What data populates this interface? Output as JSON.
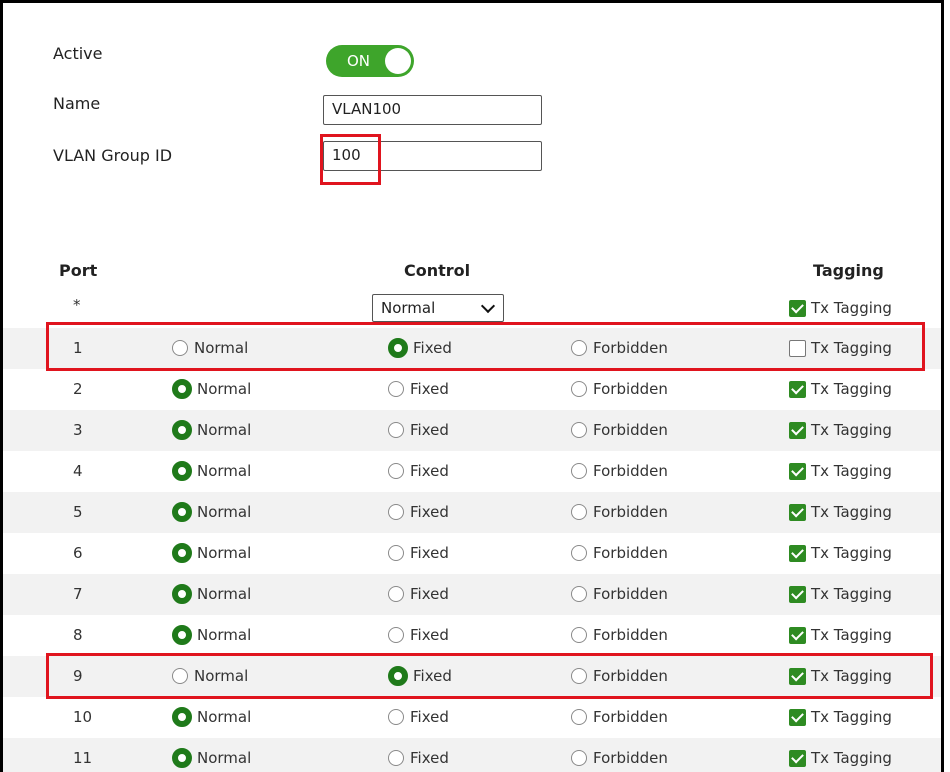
{
  "form": {
    "active_label": "Active",
    "toggle_label": "ON",
    "name_label": "Name",
    "name_value": "VLAN100",
    "vlan_group_id_label": "VLAN Group ID",
    "vlan_group_id_value": "100"
  },
  "table": {
    "headers": {
      "port": "Port",
      "control": "Control",
      "tagging": "Tagging"
    },
    "all_row": {
      "port": "*",
      "control_select": "Normal",
      "tagging_label": "Tx Tagging",
      "tagging_checked": true
    },
    "option_labels": {
      "normal": "Normal",
      "fixed": "Fixed",
      "forbidden": "Forbidden",
      "tx_tagging": "Tx Tagging"
    },
    "rows": [
      {
        "port": "1",
        "control": "fixed",
        "tx_tagging": false
      },
      {
        "port": "2",
        "control": "normal",
        "tx_tagging": true
      },
      {
        "port": "3",
        "control": "normal",
        "tx_tagging": true
      },
      {
        "port": "4",
        "control": "normal",
        "tx_tagging": true
      },
      {
        "port": "5",
        "control": "normal",
        "tx_tagging": true
      },
      {
        "port": "6",
        "control": "normal",
        "tx_tagging": true
      },
      {
        "port": "7",
        "control": "normal",
        "tx_tagging": true
      },
      {
        "port": "8",
        "control": "normal",
        "tx_tagging": true
      },
      {
        "port": "9",
        "control": "fixed",
        "tx_tagging": true
      },
      {
        "port": "10",
        "control": "normal",
        "tx_tagging": true
      },
      {
        "port": "11",
        "control": "normal",
        "tx_tagging": true
      }
    ]
  },
  "colors": {
    "accent_green": "#3ea52b",
    "radio_selected": "#1f7a1a",
    "highlight_red": "#e0141e",
    "row_shade": "#f2f2f2"
  }
}
